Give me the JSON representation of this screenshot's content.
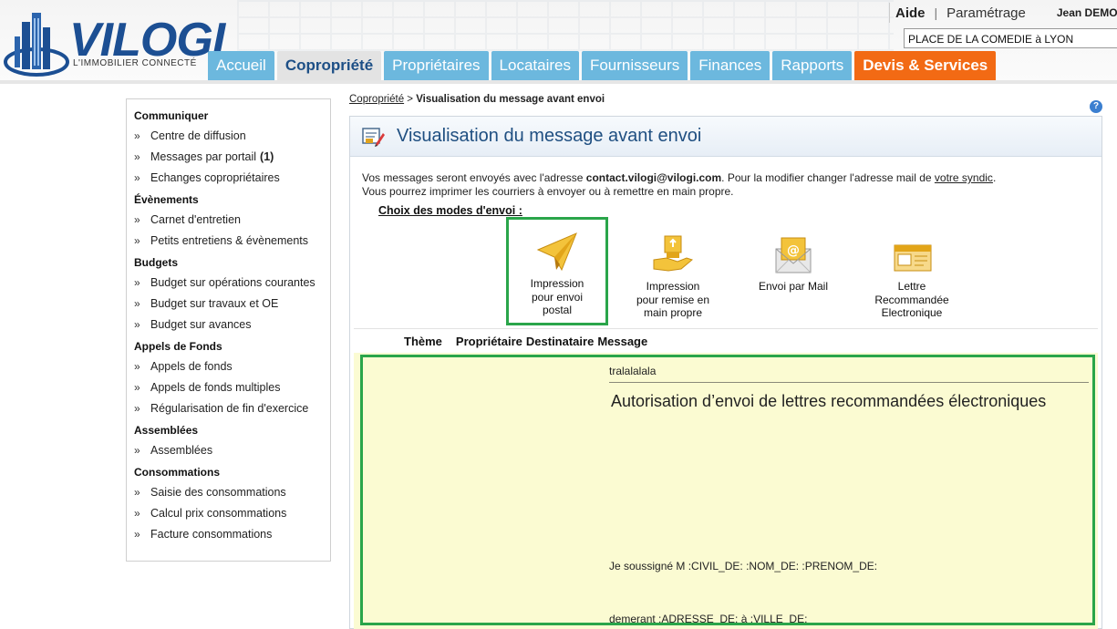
{
  "header": {
    "logo_text": "VILOGI",
    "logo_subtitle": "L'IMMOBILIER CONNECTÉ",
    "aide": "Aide",
    "separator": "|",
    "parametrage": "Paramétrage",
    "user": "Jean DEMO",
    "building": "PLACE DE LA COMEDIE à LYON"
  },
  "tabs": [
    {
      "label": "Accueil"
    },
    {
      "label": "Copropriété"
    },
    {
      "label": "Propriétaires"
    },
    {
      "label": "Locataires"
    },
    {
      "label": "Fournisseurs"
    },
    {
      "label": "Finances"
    },
    {
      "label": "Rapports"
    },
    {
      "label": "Devis & Services"
    }
  ],
  "sidebar": {
    "chevron": "»",
    "sections": [
      {
        "title": "Communiquer",
        "items": [
          "Centre de diffusion",
          "Messages par portail",
          "Echanges copropriétaires"
        ],
        "badge": "(1)"
      },
      {
        "title": "Évènements",
        "items": [
          "Carnet d'entretien",
          "Petits entretiens & évènements"
        ]
      },
      {
        "title": "Budgets",
        "items": [
          "Budget sur opérations courantes",
          "Budget sur travaux et OE",
          "Budget sur avances"
        ]
      },
      {
        "title": "Appels de Fonds",
        "items": [
          "Appels de fonds",
          "Appels de fonds multiples",
          "Régularisation de fin d'exercice"
        ]
      },
      {
        "title": "Assemblées",
        "items": [
          "Assemblées"
        ]
      },
      {
        "title": "Consommations",
        "items": [
          "Saisie des consommations",
          "Calcul prix consommations",
          "Facture consommations"
        ]
      }
    ]
  },
  "breadcrumb": {
    "link": "Copropriété",
    "separator": " > ",
    "current": "Visualisation du message avant envoi"
  },
  "help": "?",
  "panel": {
    "title": "Visualisation du message avant envoi",
    "intro_1a": "Vos messages seront envoyés avec l'adresse ",
    "intro_email": "contact.vilogi@vilogi.com",
    "intro_1b": ". Pour la modifier changer l'adresse mail de ",
    "intro_link": "votre syndic",
    "intro_1c": ".",
    "intro_2": "Vous pourrez imprimer les courriers à envoyer ou à remettre en main propre.",
    "modes_title": "Choix des modes d'envoi :",
    "modes": [
      {
        "line1": "Impression",
        "line2": "pour envoi",
        "line3": "postal",
        "icon": "paper-plane-icon"
      },
      {
        "line1": "Impression",
        "line2": "pour remise en",
        "line3": "main propre",
        "icon": "hand-delivery-icon"
      },
      {
        "line1": "Envoi par Mail",
        "line2": "",
        "line3": "",
        "icon": "email-envelope-icon"
      },
      {
        "line1": "Lettre",
        "line2": "Recommandée",
        "line3": "Electronique",
        "icon": "registered-letter-icon"
      }
    ],
    "selected_mode": 0,
    "columns": [
      "Thème",
      "Propriétaire",
      "Destinataire",
      "Message"
    ]
  },
  "message": {
    "subject": "tralalalala",
    "title": "Autorisation d’envoi de lettres recommandées électroniques",
    "line1": "Je soussigné M :CIVIL_DE: :NOM_DE: :PRENOM_DE:",
    "line2": "demerant :ADRESSE_DE: à :VILLE_DE:"
  },
  "colors": {
    "tab_blue": "#6cb8de",
    "tab_orange": "#f26a14",
    "brand_blue": "#1c4f93",
    "highlight_green": "#2aa54a",
    "message_bg": "#fbfbd2"
  }
}
